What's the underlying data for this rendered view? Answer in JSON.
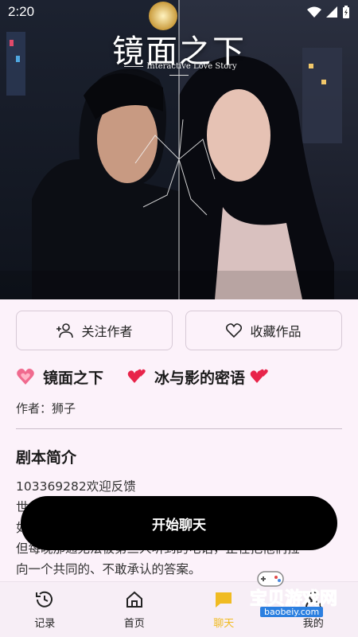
{
  "status_bar": {
    "time": "2:20"
  },
  "hero": {
    "title": "镜面之下",
    "subtitle": "Interactive Love Story"
  },
  "actions": {
    "follow_label": "关注作者",
    "favorite_label": "收藏作品"
  },
  "story": {
    "title": "镜面之下",
    "subtitle": "冰与影的密语",
    "author_label": "作者：",
    "author": "狮子"
  },
  "synopsis": {
    "heading": "剧本简介",
    "lines": [
      "103369282欢迎反馈",
      "世",
      "如",
      "但每晚那通无法被第三人听到的电话，正在把他们拉",
      "向一个共同的、不敢承认的答案。"
    ]
  },
  "cta": {
    "start_label": "开始聊天"
  },
  "nav": [
    {
      "label": "记录",
      "icon": "history-icon"
    },
    {
      "label": "首页",
      "icon": "home-icon"
    },
    {
      "label": "聊天",
      "icon": "chat-icon"
    },
    {
      "label": "我的",
      "icon": "profile-icon"
    }
  ],
  "watermark": {
    "text": "宝贝游戏网",
    "url": "baobeiy.com"
  },
  "colors": {
    "accent": "#f0bb22",
    "background": "#fcf2fa",
    "cta": "#000000"
  }
}
